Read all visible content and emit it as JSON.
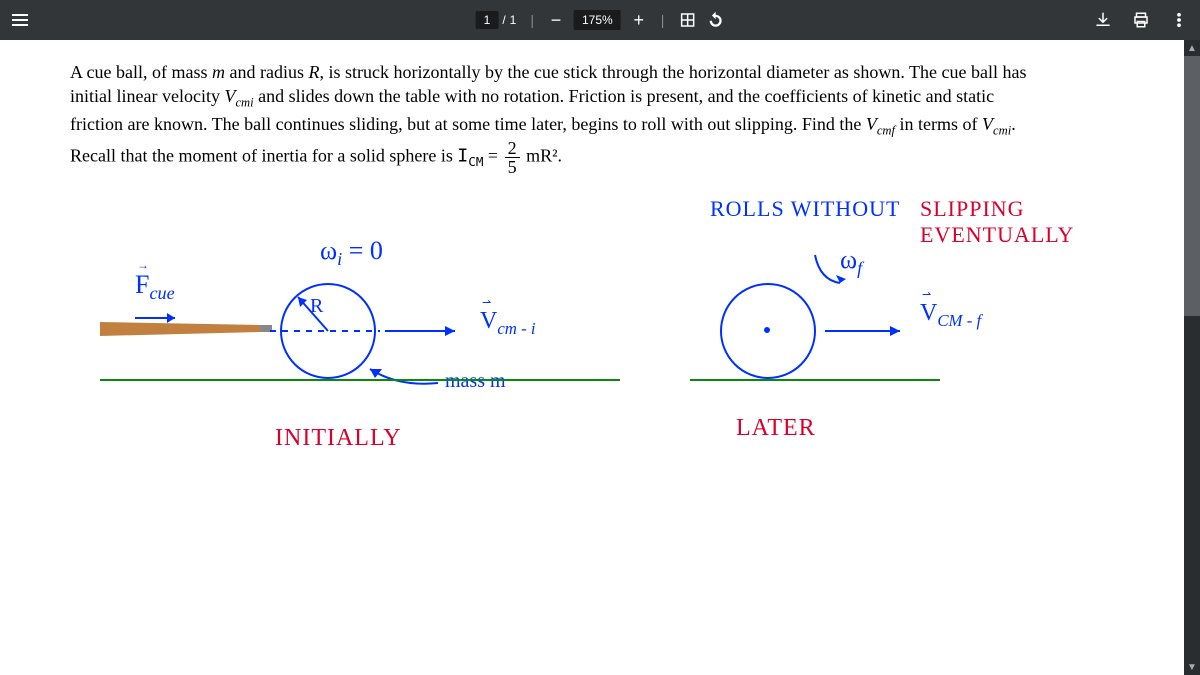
{
  "toolbar": {
    "page_current": "1",
    "page_sep": "/",
    "page_total": "1",
    "zoom_minus": "−",
    "zoom_value": "175%",
    "zoom_plus": "+"
  },
  "problem": {
    "line1_a": "A cue ball, of mass ",
    "line1_m": "m",
    "line1_b": " and radius ",
    "line1_R": "R",
    "line1_c": ", is struck horizontally by the cue stick through the horizontal diameter as shown.  The cue ball has",
    "line2_a": "initial linear velocity ",
    "line2_v": "V",
    "line2_sub": "cmi",
    "line2_b": " and slides down the table with no rotation.  Friction is present, and the coefficients of kinetic and static",
    "line3_a": "friction are known.  The ball continues sliding, but at some time later, begins to roll with out slipping.  Find the ",
    "line3_vf": "V",
    "line3_subf": "cmf",
    "line3_b": " in terms of ",
    "line3_vi": "V",
    "line3_subi": "cmi",
    "line3_dot": ".",
    "line4_a": "Recall that the moment of inertia for a solid sphere is ",
    "line4_I": "I",
    "line4_Isub": "CM",
    "line4_eq": " = ",
    "line4_num": "2",
    "line4_den": "5",
    "line4_mr": " mR²."
  },
  "diagram": {
    "rolls_without": "ROLLS   WITHOUT",
    "slipping_eventually": "SLIPPING  EVENTUALLY",
    "wi": "ω",
    "wi_sub": "i",
    "wi_eq": " = 0",
    "wf": "ω",
    "wf_sub": "f",
    "fcue": "F",
    "fcue_sub": "cue",
    "R": "R",
    "vcmi_v": "V",
    "vcmi_sub": "cm - i",
    "vcmf_v": "V",
    "vcmf_sub": "CM - f",
    "mass_m": "mass  m",
    "initially": "INITIALLY",
    "later": "LATER"
  }
}
